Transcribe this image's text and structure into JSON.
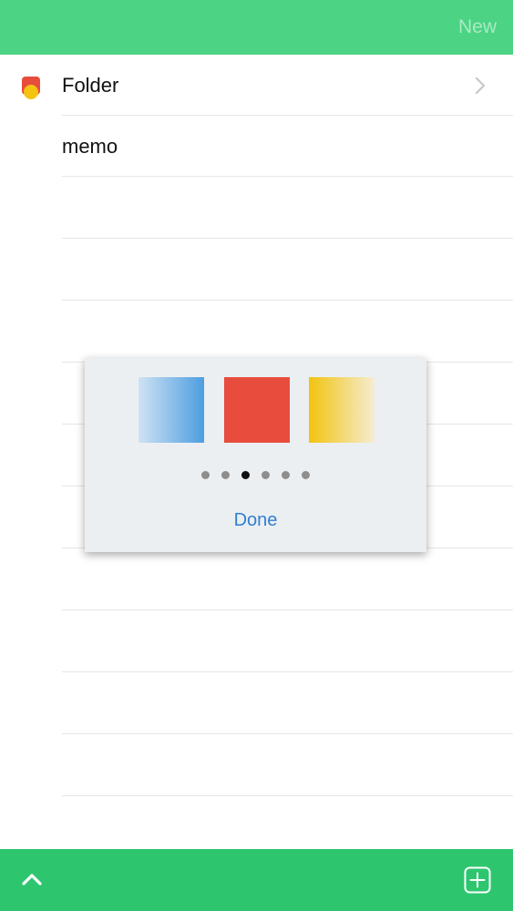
{
  "header": {
    "new_label": "New",
    "background_color": "#4cd384"
  },
  "list": {
    "items": [
      {
        "label": "Folder",
        "marker": "folder-square-icon",
        "marker_color": "#e84c3d",
        "has_chevron": true
      },
      {
        "label": "memo",
        "marker": "circle-dot-icon",
        "marker_color": "#f2c40f",
        "has_chevron": false
      }
    ]
  },
  "color_picker": {
    "swatches": [
      {
        "name": "blue",
        "color": "#4d9ee0"
      },
      {
        "name": "red",
        "color": "#e84c3d",
        "selected": true
      },
      {
        "name": "yellow",
        "color": "#f2c40f"
      }
    ],
    "page_count": 6,
    "current_page": 3,
    "done_label": "Done",
    "accent_color": "#2f7fd1"
  },
  "footer": {
    "background_color": "#2dc66f",
    "left_icon": "chevron-up-icon",
    "right_icon": "add-square-icon"
  }
}
